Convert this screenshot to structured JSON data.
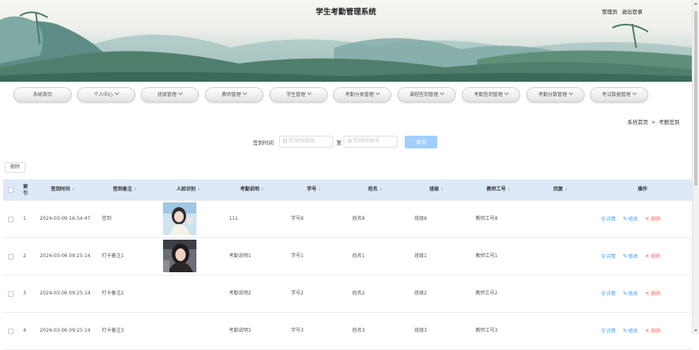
{
  "header": {
    "title": "学生考勤管理系统",
    "admin_label": "管理员",
    "logout_label": "退出登录"
  },
  "nav": [
    {
      "label": "系统首页",
      "has_dropdown": false
    },
    {
      "label": "个人中心",
      "has_dropdown": true
    },
    {
      "label": "班级管理",
      "has_dropdown": true
    },
    {
      "label": "教师管理",
      "has_dropdown": true
    },
    {
      "label": "学生管理",
      "has_dropdown": true
    },
    {
      "label": "考勤分类管理",
      "has_dropdown": true
    },
    {
      "label": "课程签到管理",
      "has_dropdown": true
    },
    {
      "label": "考勤签到管理",
      "has_dropdown": true
    },
    {
      "label": "考勤分数管理",
      "has_dropdown": true
    },
    {
      "label": "考试数据管理",
      "has_dropdown": true
    }
  ],
  "breadcrumb": {
    "home": "系统首页",
    "separator": ">",
    "current": "考勤签到"
  },
  "search": {
    "label": "签到时间",
    "start_placeholder": "签到时间起始",
    "to_label": "至",
    "end_placeholder": "签到时间结束",
    "query_button": "查询"
  },
  "toolbar": {
    "delete_button": "删除"
  },
  "table": {
    "columns": {
      "index": "索引",
      "sign_time": "签到时间",
      "sign_note": "签到备注",
      "face": "人脸识别",
      "desc": "考勤说明",
      "student_no": "学号",
      "name": "姓名",
      "class": "班级",
      "teacher_no": "教师工号",
      "reply": "回复",
      "ops": "操作"
    },
    "rows": [
      {
        "index": "1",
        "sign_time": "2024-03-09 16:54:47",
        "sign_note": "签到",
        "has_photo": true,
        "desc": "111",
        "student_no": "学号8",
        "name": "姓名8",
        "class": "班级8",
        "teacher_no": "教师工号8",
        "reply": ""
      },
      {
        "index": "2",
        "sign_time": "2024-03-06 09:25:14",
        "sign_note": "打卡备注1",
        "has_photo": true,
        "desc": "考勤说明1",
        "student_no": "学号1",
        "name": "姓名1",
        "class": "班级1",
        "teacher_no": "教师工号1",
        "reply": ""
      },
      {
        "index": "3",
        "sign_time": "2024-03-06 09:25:14",
        "sign_note": "打卡备注2",
        "has_photo": false,
        "desc": "考勤说明2",
        "student_no": "学号2",
        "name": "姓名2",
        "class": "班级2",
        "teacher_no": "教师工号2",
        "reply": ""
      },
      {
        "index": "4",
        "sign_time": "2024-03-06 09:25:14",
        "sign_note": "打卡备注3",
        "has_photo": false,
        "desc": "考勤说明3",
        "student_no": "学号3",
        "name": "姓名3",
        "class": "班级3",
        "teacher_no": "教师工号3",
        "reply": ""
      }
    ],
    "actions": {
      "detail": "详情",
      "edit": "修改",
      "delete": "删除"
    }
  },
  "icons": {
    "detail": "search-icon",
    "edit": "edit-icon",
    "delete": "close-icon",
    "dropdown": "chevron-down-icon"
  },
  "colors": {
    "primary": "#409eff",
    "danger": "#f56c6c",
    "query_button": "#a0cfff",
    "table_header": "#dde9f8"
  }
}
